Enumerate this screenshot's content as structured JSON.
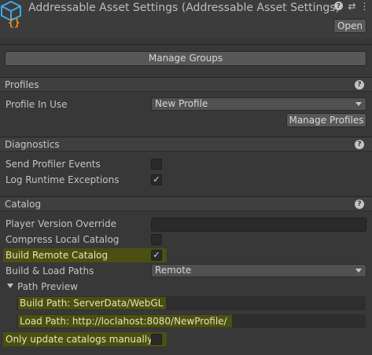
{
  "header": {
    "title": "Addressable Asset Settings (Addressable Asset Settings)",
    "open_label": "Open",
    "help_icon": "help-icon",
    "settings_icon": "sliders-icon",
    "menu_icon": "kebab-menu-icon"
  },
  "manage_groups_label": "Manage Groups",
  "profiles": {
    "title": "Profiles",
    "profile_in_use_label": "Profile In Use",
    "profile_value": "New Profile",
    "manage_profiles_label": "Manage Profiles"
  },
  "diagnostics": {
    "title": "Diagnostics",
    "send_profiler_events_label": "Send Profiler Events",
    "send_profiler_events_checked": false,
    "log_runtime_exceptions_label": "Log Runtime Exceptions",
    "log_runtime_exceptions_checked": true
  },
  "catalog": {
    "title": "Catalog",
    "player_version_override_label": "Player Version Override",
    "player_version_override_value": "",
    "compress_local_catalog_label": "Compress Local Catalog",
    "compress_local_catalog_checked": false,
    "build_remote_catalog_label": "Build Remote Catalog",
    "build_remote_catalog_checked": true,
    "build_load_paths_label": "Build & Load Paths",
    "build_load_paths_value": "Remote",
    "path_preview_label": "Path Preview",
    "build_path": "Build Path: ServerData/WebGL",
    "load_path": "Load Path: http://loclahost:8080/NewProfile/",
    "only_update_manually_label": "Only update catalogs manually",
    "only_update_manually_checked": false
  },
  "colors": {
    "background": "#383838",
    "highlight": "#4b4f12",
    "logo_blue": "#3fa9e8",
    "logo_orange": "#f08a24"
  },
  "check_mark": "✓"
}
